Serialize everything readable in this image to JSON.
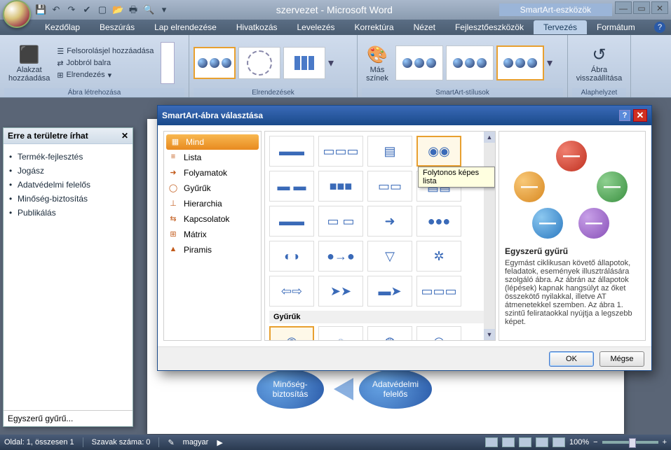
{
  "title": "szervezet - Microsoft Word",
  "context_title": "SmartArt-eszközök",
  "qat_icons": [
    "save-icon",
    "undo-icon",
    "redo-icon",
    "spellcheck-icon",
    "new-icon",
    "open-icon",
    "print-icon",
    "preview-icon"
  ],
  "win_controls": {
    "min": "—",
    "max": "▭",
    "close": "✕"
  },
  "tabs": [
    "Kezdőlap",
    "Beszúrás",
    "Lap elrendezése",
    "Hivatkozás",
    "Levelezés",
    "Korrektúra",
    "Nézet",
    "Fejlesztőeszközök",
    "Tervezés",
    "Formátum"
  ],
  "active_tab": "Tervezés",
  "ribbon": {
    "group1": {
      "label": "Ábra létrehozása",
      "add_shape": "Alakzat\nhozzáadása",
      "items": [
        "Felsorolásjel hozzáadása",
        "Jobbról balra",
        "Elrendezés"
      ]
    },
    "group2": {
      "label": "Elrendezések"
    },
    "group3": {
      "label": "SmartArt-stílusok",
      "more_colors": "Más\nszínek"
    },
    "group4": {
      "label": "Alaphelyzet",
      "reset": "Ábra\nvisszaállítása"
    }
  },
  "textpane": {
    "title": "Erre a területre írhat",
    "items": [
      "Termék-fejlesztés",
      "Jogász",
      "Adatvédelmi felelős",
      "Minőség-biztosítás",
      "Publikálás"
    ],
    "footer": "Egyszerű gyűrű..."
  },
  "dialog": {
    "title": "SmartArt-ábra választása",
    "categories": [
      "Mind",
      "Lista",
      "Folyamatok",
      "Gyűrűk",
      "Hierarchia",
      "Kapcsolatok",
      "Mátrix",
      "Piramis"
    ],
    "selected_category": "Mind",
    "tooltip": "Folytonos képes lista",
    "section2": "Gyűrűk",
    "preview_title": "Egyszerű gyűrű",
    "preview_desc": "Egymást ciklikusan követő állapotok, feladatok, események illusztrálására szolgáló ábra. Az ábrán az állapotok (lépések) kapnak hangsúlyt az őket összekötő nyilakkal, illetve AT átmenetekkel szemben. Az ábra 1. szintű felirataokkal nyújtja a legszebb képet.",
    "ok": "OK",
    "cancel": "Mégse"
  },
  "doc_shapes": {
    "s1": "Minőség-\nbiztosítás",
    "s2": "Adatvédelmi\nfelelős"
  },
  "status": {
    "page": "Oldal: 1, összesen 1",
    "words": "Szavak száma: 0",
    "lang": "magyar",
    "zoom": "100%"
  },
  "preview_colors": [
    "#d04030",
    "#e8a030",
    "#5ab060",
    "#3a8ad0",
    "#9860c8"
  ]
}
